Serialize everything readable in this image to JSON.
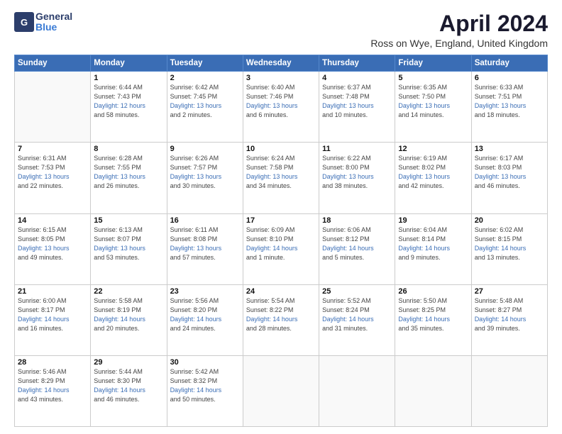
{
  "header": {
    "logo_general": "General",
    "logo_blue": "Blue",
    "month_title": "April 2024",
    "subtitle": "Ross on Wye, England, United Kingdom"
  },
  "days_of_week": [
    "Sunday",
    "Monday",
    "Tuesday",
    "Wednesday",
    "Thursday",
    "Friday",
    "Saturday"
  ],
  "weeks": [
    [
      {
        "day": "",
        "sunrise": "",
        "sunset": "",
        "daylight": ""
      },
      {
        "day": "1",
        "sunrise": "Sunrise: 6:44 AM",
        "sunset": "Sunset: 7:43 PM",
        "daylight": "Daylight: 12 hours and 58 minutes."
      },
      {
        "day": "2",
        "sunrise": "Sunrise: 6:42 AM",
        "sunset": "Sunset: 7:45 PM",
        "daylight": "Daylight: 13 hours and 2 minutes."
      },
      {
        "day": "3",
        "sunrise": "Sunrise: 6:40 AM",
        "sunset": "Sunset: 7:46 PM",
        "daylight": "Daylight: 13 hours and 6 minutes."
      },
      {
        "day": "4",
        "sunrise": "Sunrise: 6:37 AM",
        "sunset": "Sunset: 7:48 PM",
        "daylight": "Daylight: 13 hours and 10 minutes."
      },
      {
        "day": "5",
        "sunrise": "Sunrise: 6:35 AM",
        "sunset": "Sunset: 7:50 PM",
        "daylight": "Daylight: 13 hours and 14 minutes."
      },
      {
        "day": "6",
        "sunrise": "Sunrise: 6:33 AM",
        "sunset": "Sunset: 7:51 PM",
        "daylight": "Daylight: 13 hours and 18 minutes."
      }
    ],
    [
      {
        "day": "7",
        "sunrise": "Sunrise: 6:31 AM",
        "sunset": "Sunset: 7:53 PM",
        "daylight": "Daylight: 13 hours and 22 minutes."
      },
      {
        "day": "8",
        "sunrise": "Sunrise: 6:28 AM",
        "sunset": "Sunset: 7:55 PM",
        "daylight": "Daylight: 13 hours and 26 minutes."
      },
      {
        "day": "9",
        "sunrise": "Sunrise: 6:26 AM",
        "sunset": "Sunset: 7:57 PM",
        "daylight": "Daylight: 13 hours and 30 minutes."
      },
      {
        "day": "10",
        "sunrise": "Sunrise: 6:24 AM",
        "sunset": "Sunset: 7:58 PM",
        "daylight": "Daylight: 13 hours and 34 minutes."
      },
      {
        "day": "11",
        "sunrise": "Sunrise: 6:22 AM",
        "sunset": "Sunset: 8:00 PM",
        "daylight": "Daylight: 13 hours and 38 minutes."
      },
      {
        "day": "12",
        "sunrise": "Sunrise: 6:19 AM",
        "sunset": "Sunset: 8:02 PM",
        "daylight": "Daylight: 13 hours and 42 minutes."
      },
      {
        "day": "13",
        "sunrise": "Sunrise: 6:17 AM",
        "sunset": "Sunset: 8:03 PM",
        "daylight": "Daylight: 13 hours and 46 minutes."
      }
    ],
    [
      {
        "day": "14",
        "sunrise": "Sunrise: 6:15 AM",
        "sunset": "Sunset: 8:05 PM",
        "daylight": "Daylight: 13 hours and 49 minutes."
      },
      {
        "day": "15",
        "sunrise": "Sunrise: 6:13 AM",
        "sunset": "Sunset: 8:07 PM",
        "daylight": "Daylight: 13 hours and 53 minutes."
      },
      {
        "day": "16",
        "sunrise": "Sunrise: 6:11 AM",
        "sunset": "Sunset: 8:08 PM",
        "daylight": "Daylight: 13 hours and 57 minutes."
      },
      {
        "day": "17",
        "sunrise": "Sunrise: 6:09 AM",
        "sunset": "Sunset: 8:10 PM",
        "daylight": "Daylight: 14 hours and 1 minute."
      },
      {
        "day": "18",
        "sunrise": "Sunrise: 6:06 AM",
        "sunset": "Sunset: 8:12 PM",
        "daylight": "Daylight: 14 hours and 5 minutes."
      },
      {
        "day": "19",
        "sunrise": "Sunrise: 6:04 AM",
        "sunset": "Sunset: 8:14 PM",
        "daylight": "Daylight: 14 hours and 9 minutes."
      },
      {
        "day": "20",
        "sunrise": "Sunrise: 6:02 AM",
        "sunset": "Sunset: 8:15 PM",
        "daylight": "Daylight: 14 hours and 13 minutes."
      }
    ],
    [
      {
        "day": "21",
        "sunrise": "Sunrise: 6:00 AM",
        "sunset": "Sunset: 8:17 PM",
        "daylight": "Daylight: 14 hours and 16 minutes."
      },
      {
        "day": "22",
        "sunrise": "Sunrise: 5:58 AM",
        "sunset": "Sunset: 8:19 PM",
        "daylight": "Daylight: 14 hours and 20 minutes."
      },
      {
        "day": "23",
        "sunrise": "Sunrise: 5:56 AM",
        "sunset": "Sunset: 8:20 PM",
        "daylight": "Daylight: 14 hours and 24 minutes."
      },
      {
        "day": "24",
        "sunrise": "Sunrise: 5:54 AM",
        "sunset": "Sunset: 8:22 PM",
        "daylight": "Daylight: 14 hours and 28 minutes."
      },
      {
        "day": "25",
        "sunrise": "Sunrise: 5:52 AM",
        "sunset": "Sunset: 8:24 PM",
        "daylight": "Daylight: 14 hours and 31 minutes."
      },
      {
        "day": "26",
        "sunrise": "Sunrise: 5:50 AM",
        "sunset": "Sunset: 8:25 PM",
        "daylight": "Daylight: 14 hours and 35 minutes."
      },
      {
        "day": "27",
        "sunrise": "Sunrise: 5:48 AM",
        "sunset": "Sunset: 8:27 PM",
        "daylight": "Daylight: 14 hours and 39 minutes."
      }
    ],
    [
      {
        "day": "28",
        "sunrise": "Sunrise: 5:46 AM",
        "sunset": "Sunset: 8:29 PM",
        "daylight": "Daylight: 14 hours and 43 minutes."
      },
      {
        "day": "29",
        "sunrise": "Sunrise: 5:44 AM",
        "sunset": "Sunset: 8:30 PM",
        "daylight": "Daylight: 14 hours and 46 minutes."
      },
      {
        "day": "30",
        "sunrise": "Sunrise: 5:42 AM",
        "sunset": "Sunset: 8:32 PM",
        "daylight": "Daylight: 14 hours and 50 minutes."
      },
      {
        "day": "",
        "sunrise": "",
        "sunset": "",
        "daylight": ""
      },
      {
        "day": "",
        "sunrise": "",
        "sunset": "",
        "daylight": ""
      },
      {
        "day": "",
        "sunrise": "",
        "sunset": "",
        "daylight": ""
      },
      {
        "day": "",
        "sunrise": "",
        "sunset": "",
        "daylight": ""
      }
    ]
  ]
}
